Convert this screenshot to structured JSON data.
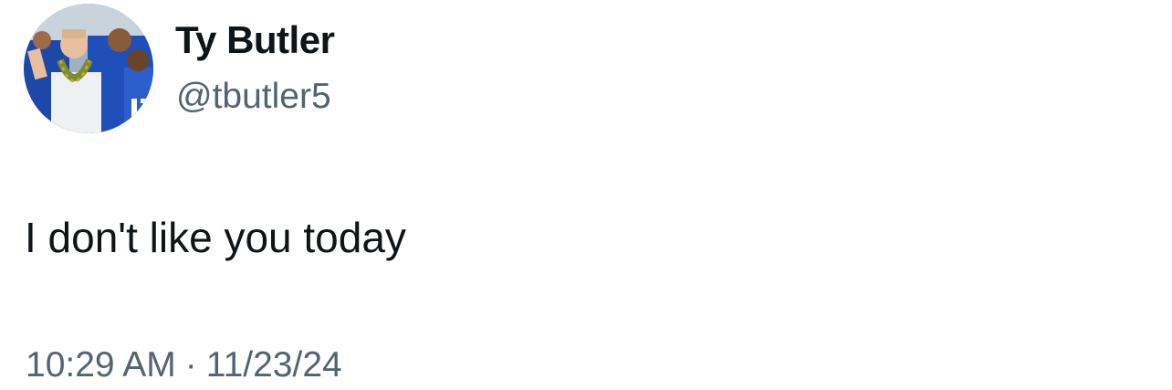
{
  "tweet": {
    "author": {
      "display_name": "Ty Butler",
      "handle": "@tbutler5",
      "avatar_icon": "profile-photo"
    },
    "text": "I don't like you today",
    "time": "10:29 AM",
    "separator": "·",
    "date": "11/23/24"
  },
  "colors": {
    "primary_text": "#0f1419",
    "secondary_text": "#536471",
    "background": "#ffffff",
    "avatar_jersey_blue": "#1f4fb8"
  }
}
